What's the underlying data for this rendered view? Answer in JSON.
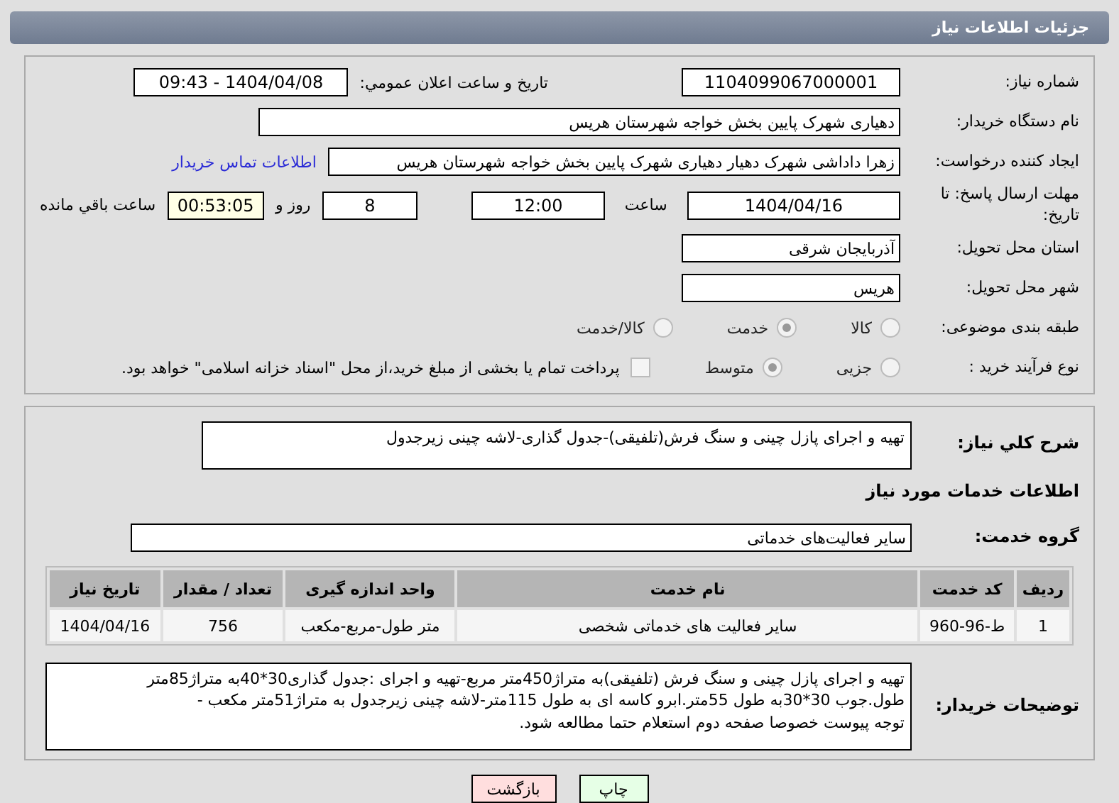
{
  "header": {
    "title": "جزئیات اطلاعات نیاز"
  },
  "need": {
    "number_label": "شماره نیاز:",
    "number": "1104099067000001",
    "announce_label": "تاريخ و ساعت اعلان عمومي:",
    "announce": "1404/04/08 - 09:43",
    "buyer_label": "نام دستگاه خريدار:",
    "buyer": "دهیاری شهرک پایین بخش خواجه شهرستان هریس",
    "creator_label": "ايجاد کننده درخواست:",
    "creator": "زهرا داداشی شهرک دهیار دهیاری شهرک پایین بخش خواجه شهرستان هریس",
    "contact_link": "اطلاعات تماس خریدار",
    "deadline_label": "مهلت ارسال پاسخ: تا تاريخ:",
    "deadline_date": "1404/04/16",
    "time_label": "ساعت",
    "deadline_time": "12:00",
    "days": "8",
    "days_label": "روز و",
    "remaining": "00:53:05",
    "remaining_label": "ساعت باقي مانده",
    "province_label": "استان محل تحويل:",
    "province": "آذربایجان شرقی",
    "city_label": "شهر محل تحويل:",
    "city": "هریس",
    "category_label": "طبقه بندی موضوعی:",
    "categories": [
      {
        "label": "کالا",
        "selected": false
      },
      {
        "label": "خدمت",
        "selected": true
      },
      {
        "label": "کالا/خدمت",
        "selected": false
      }
    ],
    "process_label": "نوع فرآیند خرید :",
    "processes": [
      {
        "label": "جزیی",
        "selected": false
      },
      {
        "label": "متوسط",
        "selected": true
      }
    ],
    "treasury": {
      "checked": false,
      "label": "پرداخت تمام یا بخشی از مبلغ خرید،از محل \"اسناد خزانه اسلامی\" خواهد بود."
    }
  },
  "details": {
    "summary_label": "شرح کلي نياز:",
    "summary": "تهیه و اجرای پازل چینی و سنگ فرش(تلفیقی)-جدول گذاری-لاشه چینی زیرجدول",
    "services_title": "اطلاعات خدمات مورد نياز",
    "group_label": "گروه خدمت:",
    "group": "سایر فعالیت‌های خدماتی",
    "table": {
      "columns": [
        "ردیف",
        "کد خدمت",
        "نام خدمت",
        "واحد اندازه گیری",
        "تعداد / مقدار",
        "تاریخ نیاز"
      ],
      "rows": [
        [
          "1",
          "ط-96-960",
          "سایر فعالیت های خدماتی شخصی",
          "متر طول-مربع-مکعب",
          "756",
          "1404/04/16"
        ]
      ]
    },
    "notes_label": "توضیحات خریدار:",
    "notes": [
      "تهیه و اجرای پازل چینی و سنگ فرش (تلفیقی)به متراژ450متر مربع-تهیه و اجرای :جدول گذاری30*40به متراژ85متر",
      "طول.جوب 30*30به طول 55متر.ابرو کاسه ای به طول 115متر-لاشه چینی زیرجدول به متراژ51متر مکعب -",
      "توجه پیوست خصوصا صفحه دوم استعلام حتما مطالعه شود."
    ]
  },
  "buttons": [
    {
      "kind": "print",
      "label": "چاپ"
    },
    {
      "kind": "back",
      "label": "بازگشت"
    }
  ]
}
